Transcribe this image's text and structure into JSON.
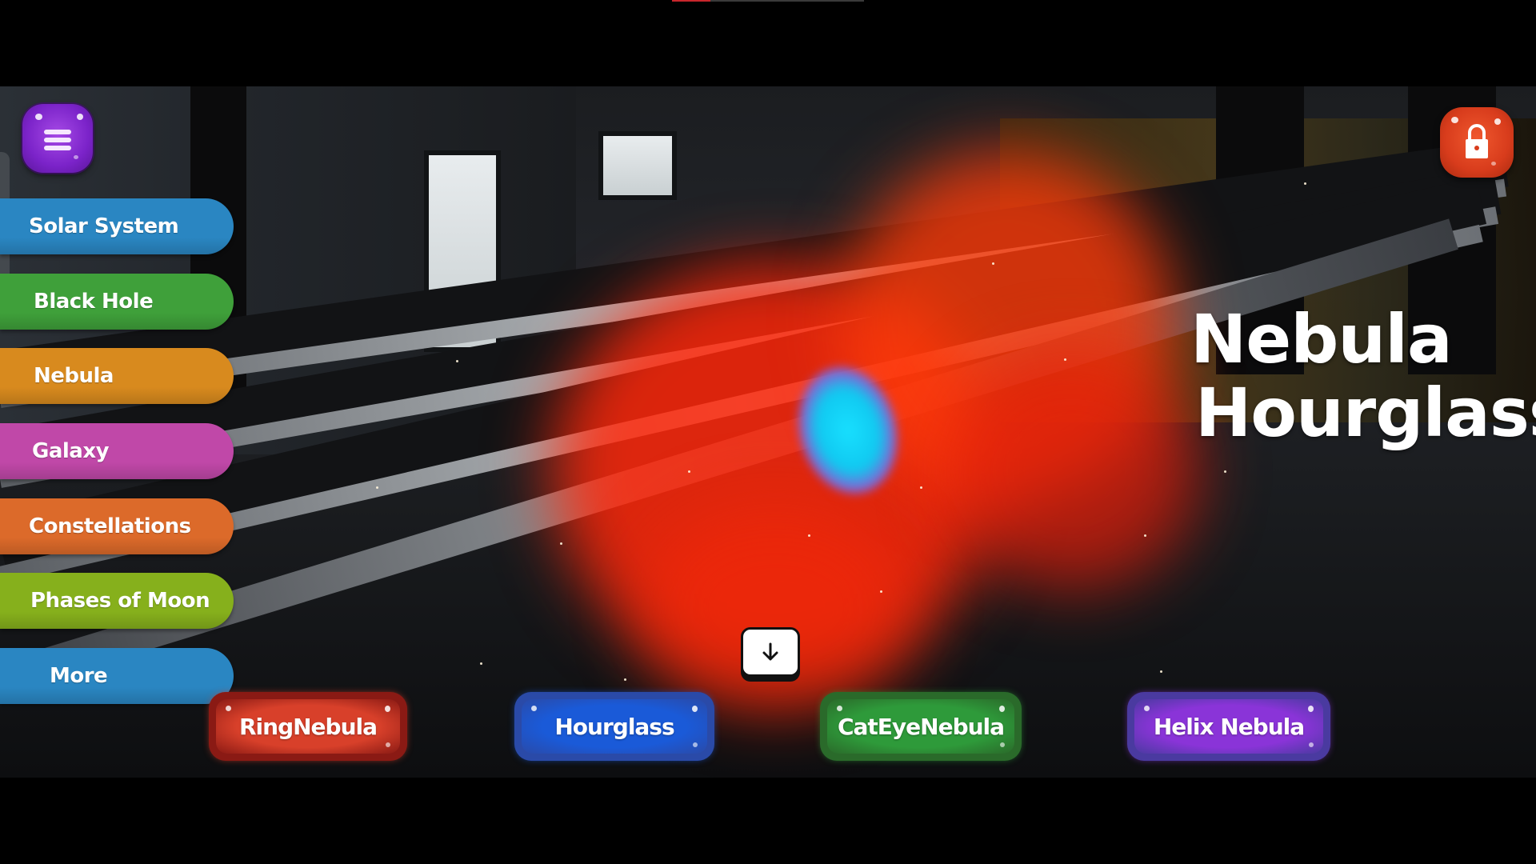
{
  "video": {
    "progress_percent": 20,
    "played_color": "#c8262c",
    "track_color": "#3a3a3a"
  },
  "header": {
    "menu_icon": "hamburger-menu-icon",
    "lock_icon": "lock-icon"
  },
  "sidebar": {
    "items": [
      {
        "label": "Solar System",
        "color": "#2a86c2"
      },
      {
        "label": "Black Hole",
        "color": "#3fa03a"
      },
      {
        "label": "Nebula",
        "color": "#d88a1e"
      },
      {
        "label": "Galaxy",
        "color": "#c048a8"
      },
      {
        "label": "Constellations",
        "color": "#dc6a2a"
      },
      {
        "label": "Phases of Moon",
        "color": "#86b01c"
      },
      {
        "label": "More",
        "color": "#2a86c2"
      }
    ]
  },
  "title": {
    "line1": "Nebula",
    "line2": "Hourglass"
  },
  "download_icon": "arrow-down-icon",
  "nebula_options": [
    {
      "label": "RingNebula",
      "color": "#d8402a",
      "border": "#8a1a14"
    },
    {
      "label": "Hourglass",
      "color": "#1a5ad8",
      "border": "#2a4aa8"
    },
    {
      "label": "CatEyeNebula",
      "color": "#2e9a3a",
      "border": "#2a6a2a"
    },
    {
      "label": "Helix Nebula",
      "color": "#8a34d8",
      "border": "#4a3aa0"
    }
  ]
}
